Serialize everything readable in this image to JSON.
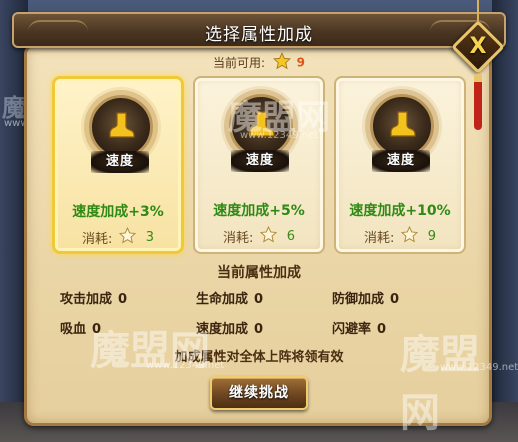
{
  "dialog": {
    "title": "选择属性加成",
    "available_label": "当前可用:",
    "available_count": "9",
    "close_label": "X"
  },
  "cards": [
    {
      "emblem_label": "速度",
      "bonus": "速度加成+3%",
      "cost_label": "消耗:",
      "cost": "3",
      "selected": true
    },
    {
      "emblem_label": "速度",
      "bonus": "速度加成+5%",
      "cost_label": "消耗:",
      "cost": "6",
      "selected": false
    },
    {
      "emblem_label": "速度",
      "bonus": "速度加成+10%",
      "cost_label": "消耗:",
      "cost": "9",
      "selected": false
    }
  ],
  "current": {
    "title": "当前属性加成",
    "stats": [
      {
        "label": "攻击加成",
        "value": "0"
      },
      {
        "label": "生命加成",
        "value": "0"
      },
      {
        "label": "防御加成",
        "value": "0"
      },
      {
        "label": "吸血",
        "value": "0"
      },
      {
        "label": "速度加成",
        "value": "0"
      },
      {
        "label": "闪避率",
        "value": "0"
      }
    ]
  },
  "note": "加成属性对全体上阵将领有效",
  "continue_button": "继续挑战",
  "watermark": {
    "brand": "魔盟网",
    "url": "www.12349.net"
  },
  "colors": {
    "bonus_green": "#2e8a14",
    "star_gold": "#f6c623",
    "count_orange": "#e0541a"
  }
}
